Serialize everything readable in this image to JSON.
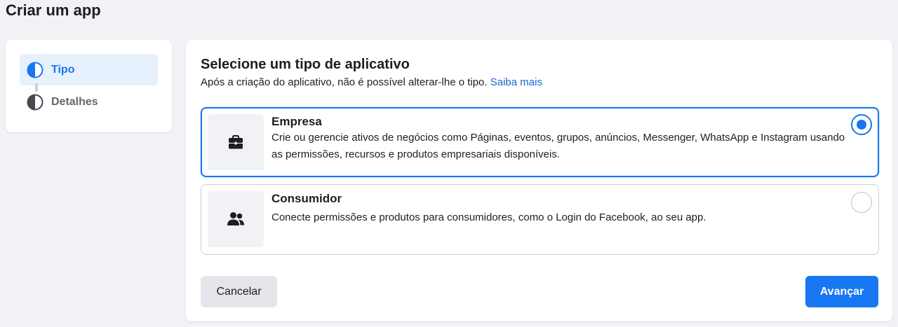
{
  "page": {
    "title": "Criar um app"
  },
  "steps": [
    {
      "label": "Tipo",
      "state": "active"
    },
    {
      "label": "Detalhes",
      "state": "inactive"
    }
  ],
  "main": {
    "title": "Selecione um tipo de aplicativo",
    "subtitle": "Após a criação do aplicativo, não é possível alterar-lhe o tipo.",
    "learn_more": "Saiba mais"
  },
  "options": [
    {
      "title": "Empresa",
      "description": "Crie ou gerencie ativos de negócios como Páginas, eventos, grupos, anúncios, Messenger, WhatsApp e Instagram usando as permissões, recursos e produtos empresariais disponíveis.",
      "icon": "briefcase-icon",
      "selected": true
    },
    {
      "title": "Consumidor",
      "description": "Conecte permissões e produtos para consumidores, como o Login do Facebook, ao seu app.",
      "icon": "people-icon",
      "selected": false
    }
  ],
  "buttons": {
    "cancel": "Cancelar",
    "next": "Avançar"
  },
  "colors": {
    "accent": "#1877f2",
    "link": "#1a66d2",
    "background": "#f0f2f5"
  }
}
